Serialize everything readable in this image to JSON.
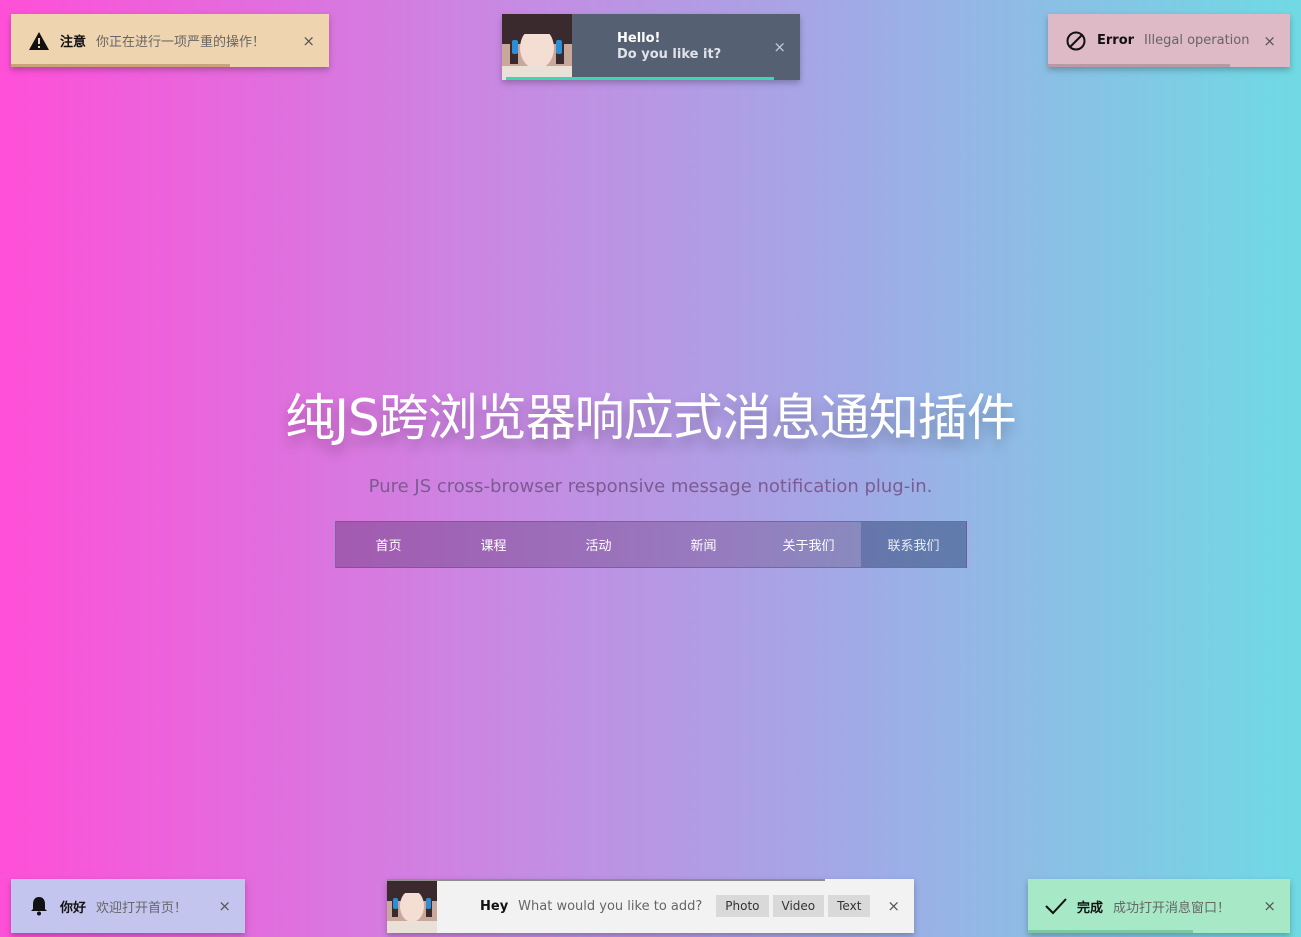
{
  "hero": {
    "title": "纯JS跨浏览器响应式消息通知插件",
    "subtitle": "Pure JS cross-browser responsive message notification plug-in."
  },
  "menu": {
    "items": [
      {
        "label": "首页"
      },
      {
        "label": "课程"
      },
      {
        "label": "活动"
      },
      {
        "label": "新闻"
      },
      {
        "label": "关于我们"
      },
      {
        "label": "联系我们"
      }
    ],
    "active_index": 5
  },
  "notifications": {
    "warning": {
      "icon": "warning-icon",
      "title": "注意",
      "message": "你正在进行一项严重的操作！",
      "close": "×",
      "progress": 0.69
    },
    "hello": {
      "avatar": "avatar-image",
      "line1": "Hello!",
      "line2": "Do you like it?",
      "close": "×",
      "progress": 0.9
    },
    "error": {
      "icon": "prohibited-icon",
      "title": "Error",
      "message": "Illegal operation",
      "close": "×",
      "progress": 0.75
    },
    "info": {
      "icon": "bell-icon",
      "title": "你好",
      "message": "欢迎打开首页！",
      "close": "×"
    },
    "hey": {
      "avatar": "avatar-image",
      "title": "Hey",
      "message": "What would you like to add?",
      "buttons": [
        {
          "label": "Photo"
        },
        {
          "label": "Video"
        },
        {
          "label": "Text"
        }
      ],
      "close": "×"
    },
    "success": {
      "icon": "checkmark-icon",
      "title": "完成",
      "message": "成功打开消息窗口！",
      "close": "×",
      "progress": 0.63
    }
  },
  "colors": {
    "bg_left": "#ff4fd8",
    "bg_right": "#6fdae4",
    "warning_bg": "#efd4b0",
    "error_bg": "#deb9c6",
    "info_bg": "#c3c5ef",
    "success_bg": "#a7e8c7",
    "hello_bg": "#566073",
    "hello_accent": "#3ed8b0"
  }
}
